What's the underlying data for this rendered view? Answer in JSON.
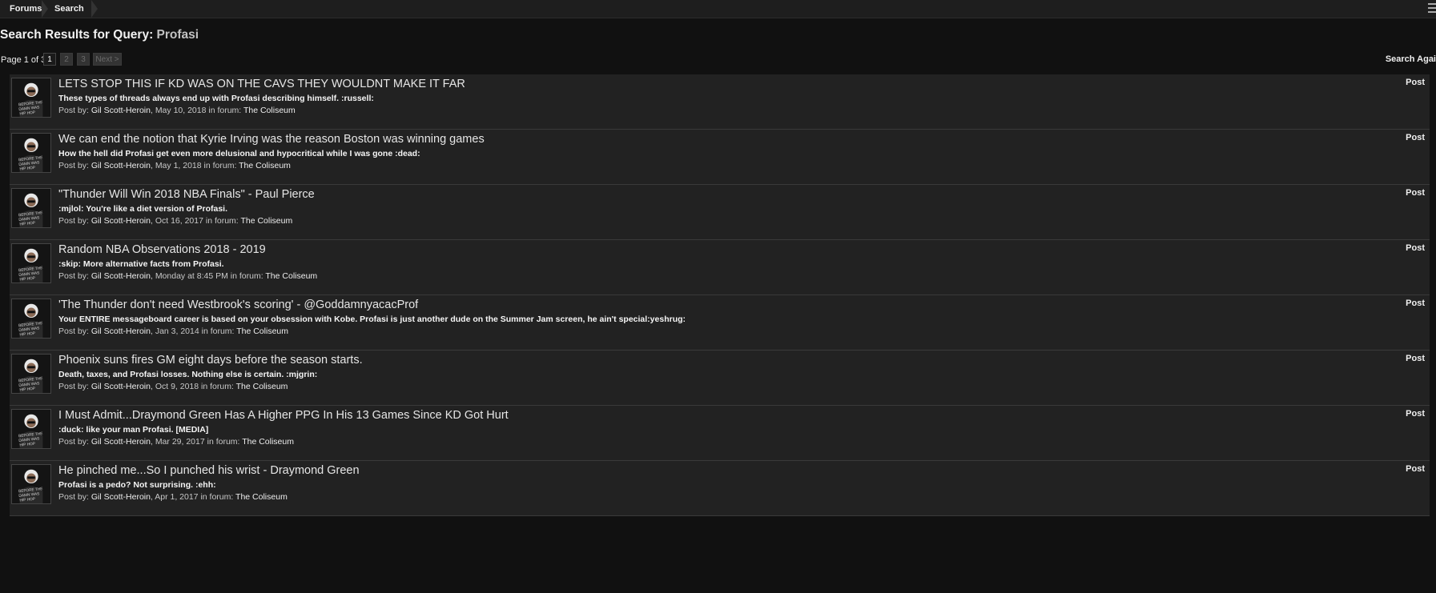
{
  "breadcrumb": {
    "items": [
      "Forums",
      "Search"
    ]
  },
  "header": {
    "title_prefix": "Search Results for Query:",
    "query": "Profasi"
  },
  "pager": {
    "label": "Page 1 of 3",
    "pages": [
      "1",
      "2",
      "3"
    ],
    "current": "1",
    "next_label": "Next >"
  },
  "search_again_label": "Search Agai",
  "results": [
    {
      "title": "LETS STOP THIS IF KD WAS ON THE CAVS THEY WOULDNT MAKE IT FAR",
      "snippet": "These types of threads always end up with Profasi describing himself. :russell:",
      "meta_prefix": "Post by:",
      "author": "Gil Scott-Heroin",
      "date": "May 10, 2018",
      "forum_prefix": "in forum:",
      "forum": "The Coliseum",
      "content_type": "Post"
    },
    {
      "title": "We can end the notion that Kyrie Irving was the reason Boston was winning games",
      "snippet": "How the hell did Profasi get even more delusional and hypocritical while I was gone :dead:",
      "meta_prefix": "Post by:",
      "author": "Gil Scott-Heroin",
      "date": "May 1, 2018",
      "forum_prefix": "in forum:",
      "forum": "The Coliseum",
      "content_type": "Post"
    },
    {
      "title": "\"Thunder Will Win 2018 NBA Finals\" - Paul Pierce",
      "snippet": ":mjlol: You're like a diet version of Profasi.",
      "meta_prefix": "Post by:",
      "author": "Gil Scott-Heroin",
      "date": "Oct 16, 2017",
      "forum_prefix": "in forum:",
      "forum": "The Coliseum",
      "content_type": "Post"
    },
    {
      "title": "Random NBA Observations 2018 - 2019",
      "snippet": ":skip: More alternative facts from Profasi.",
      "meta_prefix": "Post by:",
      "author": "Gil Scott-Heroin",
      "date": "Monday at 8:45 PM",
      "forum_prefix": "in forum:",
      "forum": "The Coliseum",
      "content_type": "Post"
    },
    {
      "title": "'The Thunder don't need Westbrook's scoring' - @GoddamnyacacProf",
      "snippet": "Your ENTIRE messageboard career is based on your obsession with Kobe. Profasi is just another dude on the Summer Jam screen, he ain't special:yeshrug:",
      "meta_prefix": "Post by:",
      "author": "Gil Scott-Heroin",
      "date": "Jan 3, 2014",
      "forum_prefix": "in forum:",
      "forum": "The Coliseum",
      "content_type": "Post"
    },
    {
      "title": "Phoenix suns fires GM eight days before the season starts.",
      "snippet": "Death, taxes, and Profasi losses. Nothing else is certain. :mjgrin:",
      "meta_prefix": "Post by:",
      "author": "Gil Scott-Heroin",
      "date": "Oct 9, 2018",
      "forum_prefix": "in forum:",
      "forum": "The Coliseum",
      "content_type": "Post"
    },
    {
      "title": "I Must Admit...Draymond Green Has A Higher PPG In His 13 Games Since KD Got Hurt",
      "snippet": ":duck: like your man Profasi. [MEDIA]",
      "meta_prefix": "Post by:",
      "author": "Gil Scott-Heroin",
      "date": "Mar 29, 2017",
      "forum_prefix": "in forum:",
      "forum": "The Coliseum",
      "content_type": "Post"
    },
    {
      "title": "He pinched me...So I punched his wrist - Draymond Green",
      "snippet": "Profasi is a pedo? Not surprising. :ehh:",
      "meta_prefix": "Post by:",
      "author": "Gil Scott-Heroin",
      "date": "Apr 1, 2017",
      "forum_prefix": "in forum:",
      "forum": "The Coliseum",
      "content_type": "Post"
    }
  ],
  "icons": {
    "menu": "hamburger-menu-icon",
    "avatar": "user-avatar-image"
  },
  "colors": {
    "background": "#111111",
    "row": "#222222",
    "text": "#e6e6e6"
  }
}
